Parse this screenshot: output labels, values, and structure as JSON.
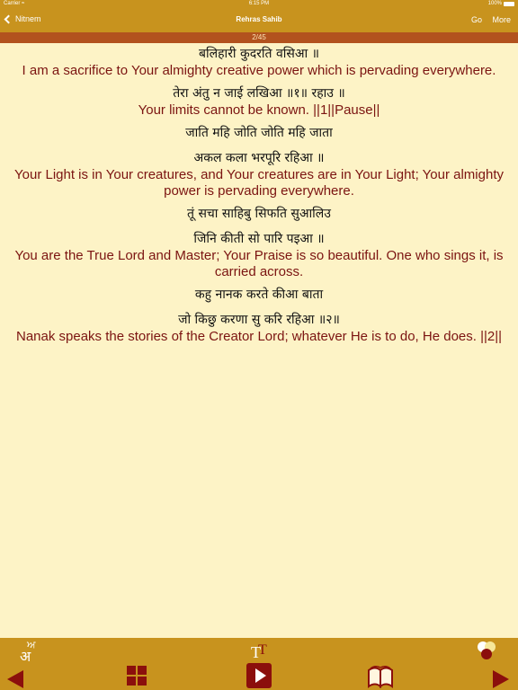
{
  "status_bar": {
    "carrier": "Carrier",
    "time": "6:15 PM",
    "battery": "100%"
  },
  "nav": {
    "back_label": "Nitnem",
    "title": "Rehras Sahib",
    "go_label": "Go",
    "more_label": "More"
  },
  "progress": {
    "page_label": "2/45"
  },
  "verses": [
    {
      "gurmukhi": [
        "बलिहारी कुदरति वसिआ ॥"
      ],
      "translation": "I am a sacrifice to Your almighty creative power which is pervading everywhere."
    },
    {
      "gurmukhi": [
        "तेरा अंतु न जाई लखिआ ॥१॥ रहाउ ॥"
      ],
      "translation": "Your limits cannot be known. ||1||Pause||"
    },
    {
      "gurmukhi": [
        "जाति महि जोति जोति महि जाता",
        "अकल कला भरपूरि रहिआ ॥"
      ],
      "translation": "Your Light is in Your creatures, and Your creatures are in Your Light; Your almighty power is pervading everywhere."
    },
    {
      "gurmukhi": [
        "तूं सचा साहिबु सिफति सुआलिउ",
        "जिनि कीती सो पारि पइआ ॥"
      ],
      "translation": "You are the True Lord and Master; Your Praise is so beautiful. One who sings it, is carried across."
    },
    {
      "gurmukhi": [
        "कहु नानक करते कीआ बाता",
        "जो किछु करणा सु करि रहिआ ॥२॥"
      ],
      "translation": "Nanak speaks the stories of the Creator Lord; whatever He is to do, He does. ||2||"
    }
  ],
  "toolbar": {
    "language_glyph_small": "ਅ",
    "language_glyph_large": "अ"
  },
  "colors": {
    "bar": "#c8931e",
    "progress_strip": "#b2521e",
    "background": "#fdf3c6",
    "translation_text": "#7b1411",
    "button_dark_red": "#8b0f0c"
  }
}
